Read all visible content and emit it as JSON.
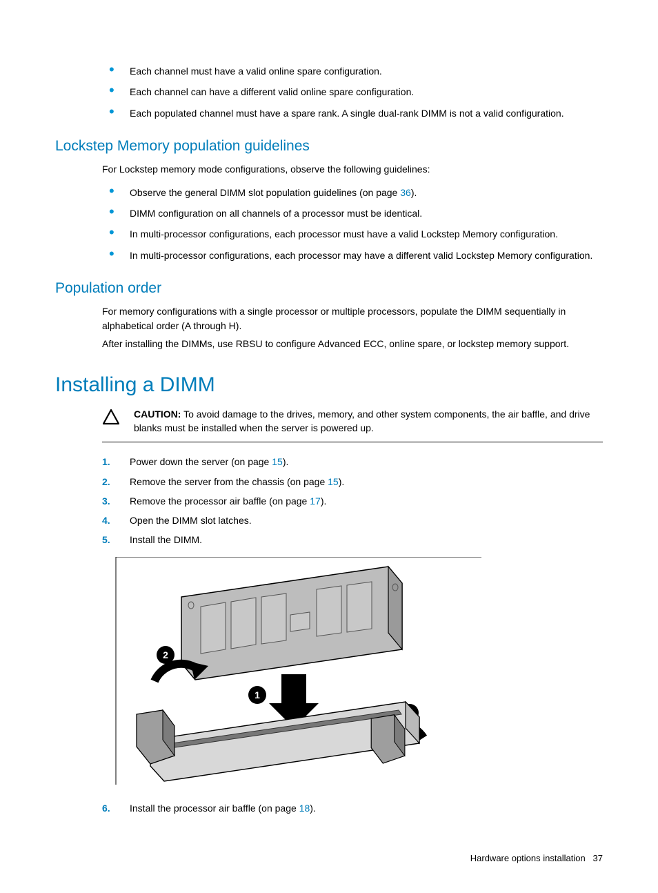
{
  "intro_bullets": [
    "Each channel must have a valid online spare configuration.",
    "Each channel can have a different valid online spare configuration.",
    "Each populated channel must have a spare rank. A single dual-rank DIMM is not a valid configuration."
  ],
  "lockstep": {
    "heading": "Lockstep Memory population guidelines",
    "intro": "For Lockstep memory mode configurations, observe the following guidelines:",
    "bullets": [
      {
        "pre": "Observe the general DIMM slot population guidelines (on page ",
        "page": "36",
        "post": ")."
      },
      {
        "pre": "DIMM configuration on all channels of a processor must be identical.",
        "page": "",
        "post": ""
      },
      {
        "pre": "In multi-processor configurations, each processor must have a valid Lockstep Memory configuration.",
        "page": "",
        "post": ""
      },
      {
        "pre": "In multi-processor configurations, each processor may have a different valid Lockstep Memory configuration.",
        "page": "",
        "post": ""
      }
    ]
  },
  "population": {
    "heading": "Population order",
    "p1": "For memory configurations with a single processor or multiple processors, populate the DIMM sequentially in alphabetical order (A through H).",
    "p2": "After installing the DIMMs, use RBSU to configure Advanced ECC, online spare, or lockstep memory support."
  },
  "installing": {
    "heading": "Installing a DIMM",
    "caution_label": "CAUTION:",
    "caution_text": " To avoid damage to the drives, memory, and other system components, the air baffle, and drive blanks must be installed when the server is powered up.",
    "steps": [
      {
        "pre": "Power down the server (on page ",
        "page": "15",
        "post": ")."
      },
      {
        "pre": "Remove the server from the chassis (on page ",
        "page": "15",
        "post": ")."
      },
      {
        "pre": "Remove the processor air baffle (on page ",
        "page": "17",
        "post": ")."
      },
      {
        "pre": "Open the DIMM slot latches.",
        "page": "",
        "post": ""
      },
      {
        "pre": "Install the DIMM.",
        "page": "",
        "post": ""
      }
    ],
    "step6": {
      "pre": "Install the processor air baffle (on page ",
      "page": "18",
      "post": ")."
    }
  },
  "footer": {
    "section": "Hardware options installation",
    "page": "37"
  }
}
